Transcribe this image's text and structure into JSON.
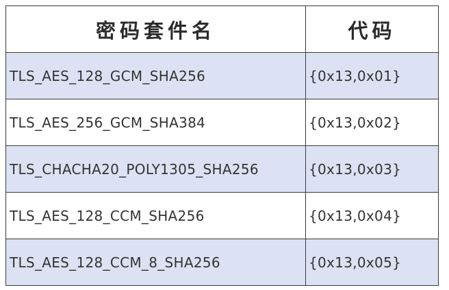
{
  "table": {
    "headers": {
      "name": "密码套件名",
      "code": "代码"
    },
    "colors": {
      "shaded_row": "#dce2f3",
      "plain_row": "#ffffff",
      "border": "#3a3a3a"
    },
    "rows": [
      {
        "name": "TLS_AES_128_GCM_SHA256",
        "code": "{0x13,0x01}"
      },
      {
        "name": "TLS_AES_256_GCM_SHA384",
        "code": "{0x13,0x02}"
      },
      {
        "name": "TLS_CHACHA20_POLY1305_SHA256",
        "code": "{0x13,0x03}"
      },
      {
        "name": "TLS_AES_128_CCM_SHA256",
        "code": "{0x13,0x04}"
      },
      {
        "name": "TLS_AES_128_CCM_8_SHA256",
        "code": "{0x13,0x05}"
      }
    ]
  }
}
